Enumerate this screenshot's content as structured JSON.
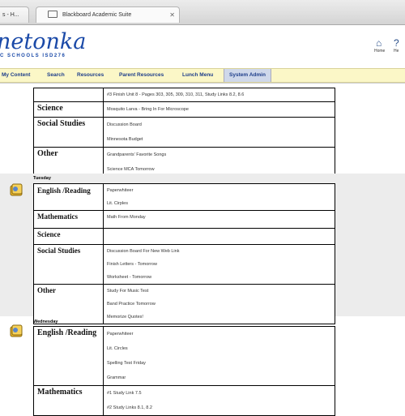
{
  "browser": {
    "tabs": [
      {
        "label": "s - H..."
      },
      {
        "label": "Blackboard Academic Suite"
      }
    ]
  },
  "header": {
    "logo_main": "netonka",
    "logo_sub": "C SCHOOLS  ISD276",
    "icons": [
      {
        "name": "home-icon",
        "label": "Home"
      },
      {
        "name": "help-icon",
        "label": "He"
      }
    ]
  },
  "nav": {
    "items": [
      {
        "label": "My Content"
      },
      {
        "label": "Search"
      },
      {
        "label": "Resources"
      },
      {
        "label": "Parent Resources"
      },
      {
        "label": "Lunch Menu"
      },
      {
        "label": "System Admin"
      }
    ]
  },
  "monday": {
    "rows": [
      {
        "subject": "",
        "items": [
          "#3 Finish Unit 8 - Pages 303, 305, 309, 310, 311, Study Links 8.2, 8.6"
        ]
      },
      {
        "subject": "Science",
        "items": [
          "Mosquito Larva - Bring In For Microscope"
        ]
      },
      {
        "subject": "Social Studies",
        "items": [
          "Discussion Board",
          "Minnesota Budget"
        ]
      },
      {
        "subject": "Other",
        "items": [
          "Grandparents' Favorite Songs",
          "Science MCA Tomorrow"
        ]
      }
    ]
  },
  "tuesday": {
    "label": "Tuesday",
    "rows": [
      {
        "subject": "English /Reading",
        "items": [
          "Paperwhiteer",
          "Lit. Cirples"
        ]
      },
      {
        "subject": "Mathematics",
        "items": [
          "Math From Monday"
        ]
      },
      {
        "subject": "Science",
        "items": [
          ""
        ]
      },
      {
        "subject": "Social Studies",
        "items": [
          "Discussion Board For New Web Link",
          "Finish Letters - Tomorrow",
          "Worksheet - Tomorrow"
        ]
      },
      {
        "subject": "Other",
        "items": [
          "Study For Music Test",
          "Band Practice Tomorrow",
          "Memorize Quotes!"
        ]
      }
    ]
  },
  "wednesday": {
    "label": "Wednesday",
    "rows": [
      {
        "subject": "English /Reading",
        "items": [
          "Paperwhiteer",
          "Lit. Circles",
          "Spelling Test Friday",
          "Grammar"
        ]
      },
      {
        "subject": "Mathematics",
        "items": [
          "#1 Study Link 7.5",
          "#2 Study Links 8.1, 8.2"
        ]
      }
    ]
  }
}
